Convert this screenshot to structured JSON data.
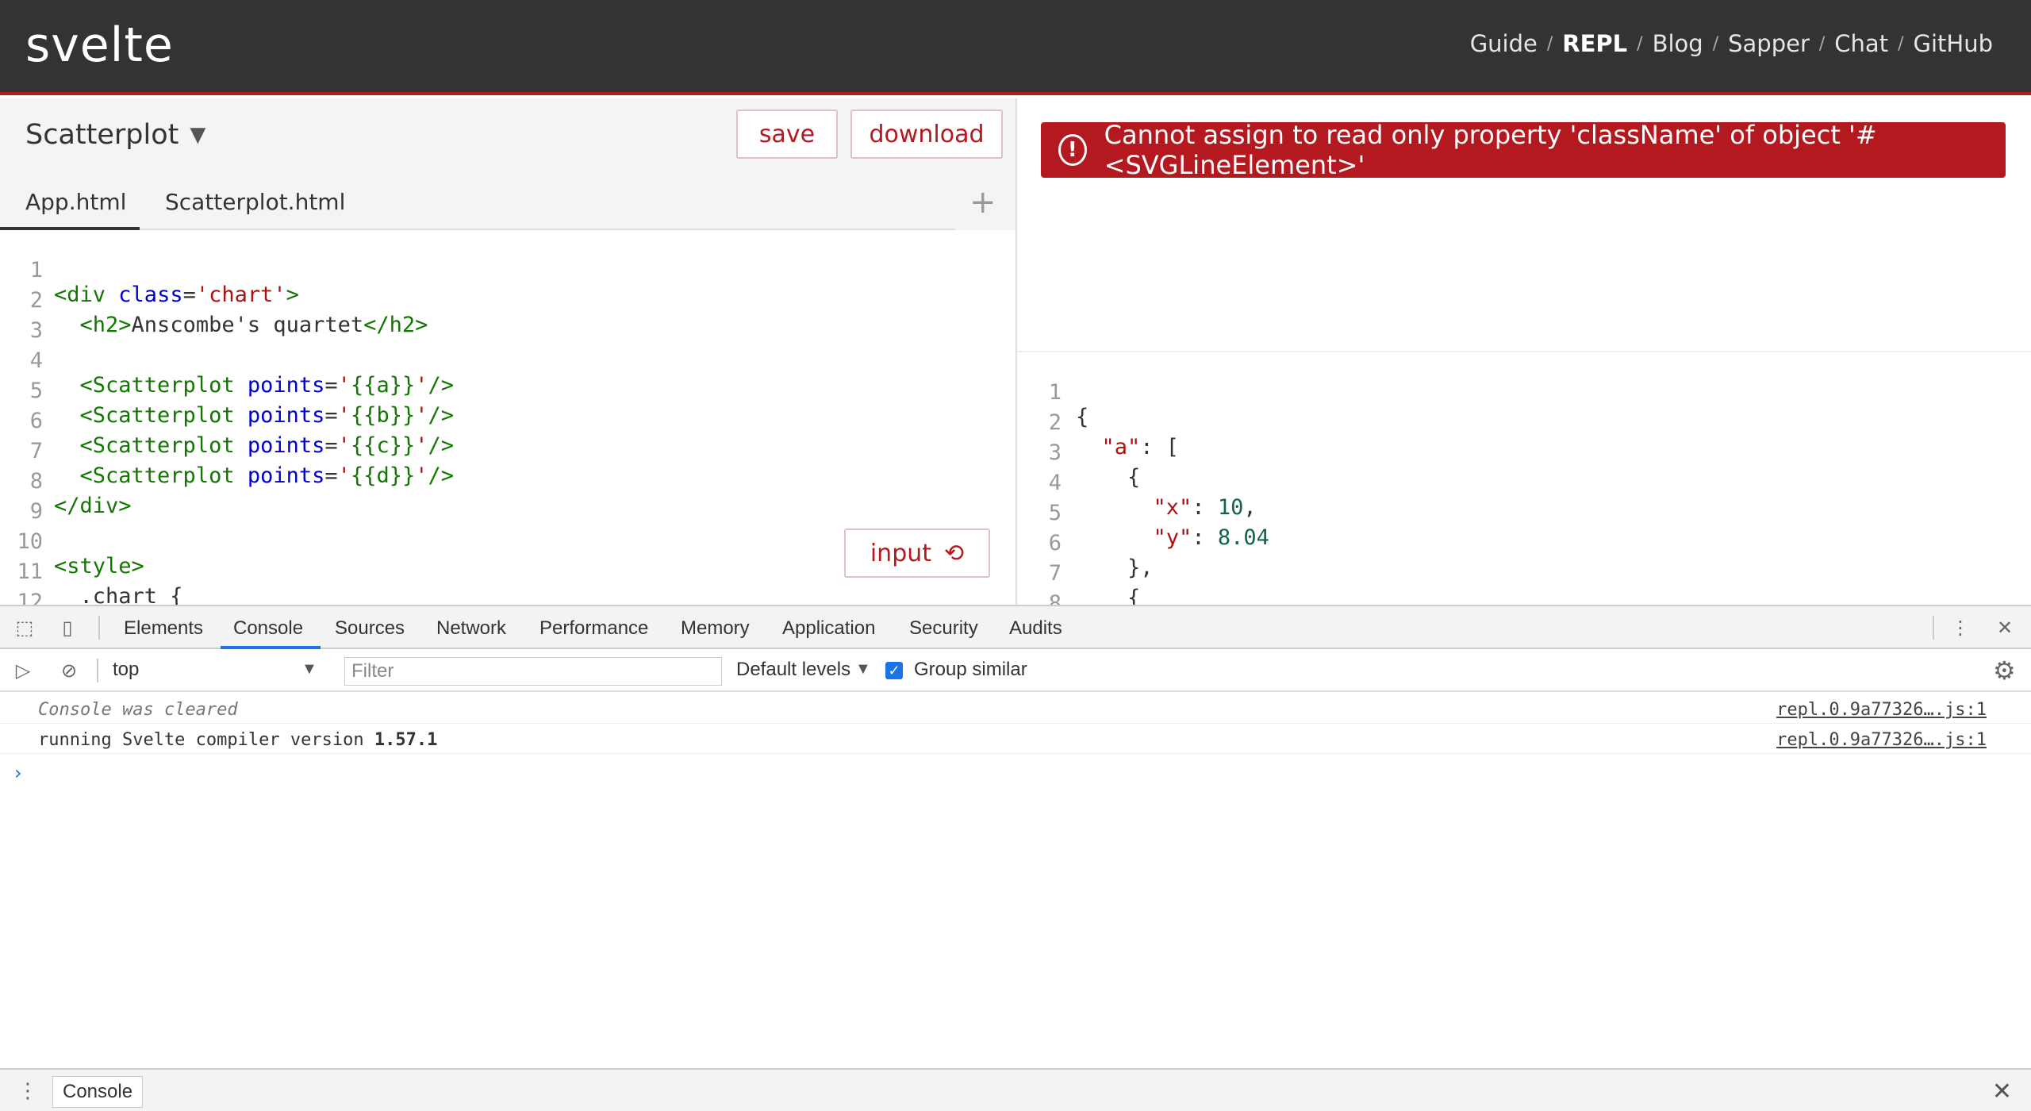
{
  "nav": {
    "logo": "svelte",
    "links": [
      "Guide",
      "REPL",
      "Blog",
      "Sapper",
      "Chat",
      "GitHub"
    ],
    "separator": "/"
  },
  "component_bar": {
    "name": "Scatterplot",
    "save_label": "save",
    "download_label": "download"
  },
  "tabs": [
    "App.html",
    "Scatterplot.html"
  ],
  "add_tab_icon": "+",
  "editor": {
    "line_numbers": [
      "1",
      "2",
      "3",
      "4",
      "5",
      "6",
      "7",
      "8",
      "9",
      "10",
      "11",
      "12"
    ],
    "input_button": "input"
  },
  "error": {
    "message": "Cannot assign to read only property 'className' of object '#<SVGLineElement>'"
  },
  "json_viewer": {
    "line_numbers": [
      "1",
      "2",
      "3",
      "4",
      "5",
      "6",
      "7",
      "8"
    ]
  },
  "devtools": {
    "tabs": [
      "Elements",
      "Console",
      "Sources",
      "Network",
      "Performance",
      "Memory",
      "Application",
      "Security",
      "Audits"
    ],
    "context": "top",
    "filter_placeholder": "Filter",
    "levels": "Default levels",
    "group_similar": "Group similar",
    "messages": [
      {
        "text": "Console was cleared",
        "source": "repl.0.9a77326….js:1"
      },
      {
        "text_prefix": "running Svelte compiler version ",
        "version": "1.57.1",
        "source": "repl.0.9a77326….js:1"
      }
    ],
    "drawer_tab": "Console"
  },
  "colors": {
    "brand_red": "#b3191f",
    "nav_bg": "#333333",
    "devtools_blue": "#1a73e8"
  }
}
